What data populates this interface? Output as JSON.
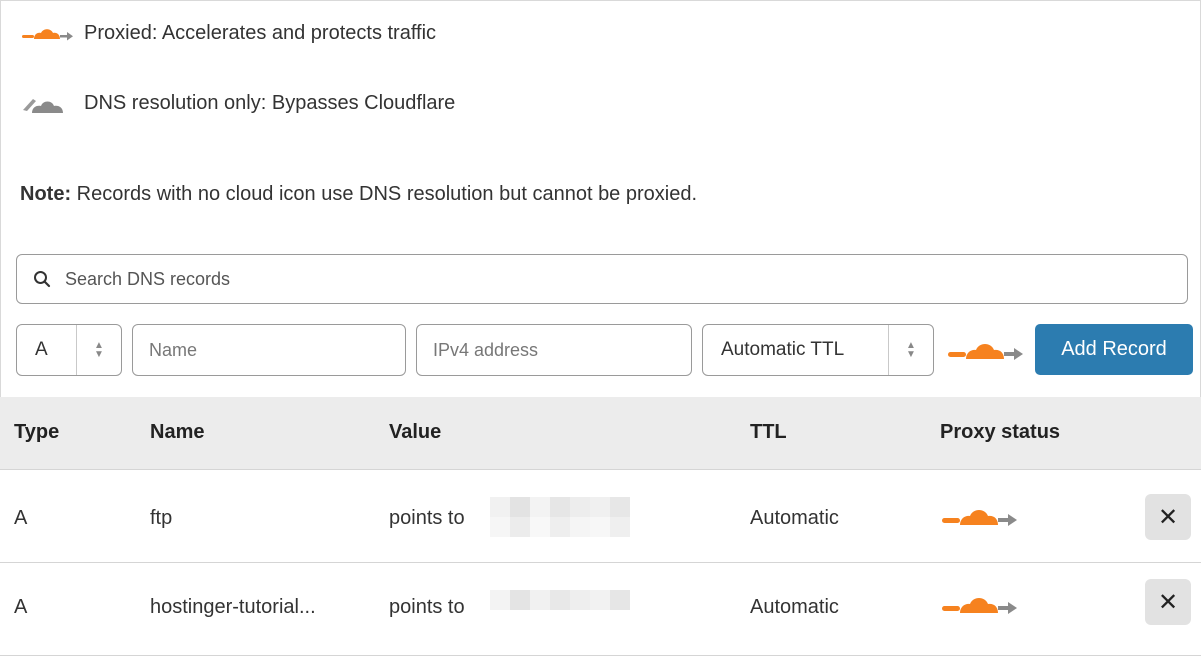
{
  "legend": {
    "proxied_text": "Proxied: Accelerates and protects traffic",
    "proxied_icon": "orange-cloud-icon",
    "dns_only_text": "DNS resolution only: Bypasses Cloudflare",
    "dns_only_icon": "grey-cloud-icon"
  },
  "note": {
    "label": "Note:",
    "text": " Records with no cloud icon use DNS resolution but cannot be proxied."
  },
  "search": {
    "placeholder": "Search DNS records",
    "value": ""
  },
  "add_form": {
    "type_value": "A",
    "name_placeholder": "Name",
    "ipv4_placeholder": "IPv4 address",
    "ttl_value": "Automatic TTL",
    "proxy_icon": "orange-cloud-icon",
    "add_button_label": "Add Record"
  },
  "table": {
    "headers": {
      "type": "Type",
      "name": "Name",
      "value": "Value",
      "ttl": "TTL",
      "proxy_status": "Proxy status"
    },
    "rows": [
      {
        "type": "A",
        "name": "ftp",
        "value_prefix": "points to",
        "ttl": "Automatic",
        "proxy_icon": "orange-cloud-icon",
        "delete_icon": "close-icon"
      },
      {
        "type": "A",
        "name": "hostinger-tutorial...",
        "value_prefix": "points to",
        "ttl": "Automatic",
        "proxy_icon": "orange-cloud-icon",
        "delete_icon": "close-icon"
      }
    ]
  },
  "colors": {
    "accent_blue": "#2c7cb0",
    "cloud_orange": "#f6821f",
    "cloud_grey": "#8a8a8a",
    "header_bg": "#ececec"
  },
  "delete_symbol": "✕"
}
